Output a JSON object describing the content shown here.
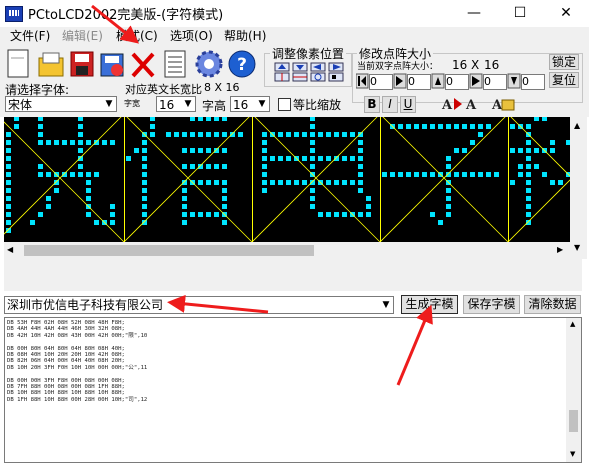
{
  "window": {
    "title": "PCtoLCD2002完美版-(字符模式)",
    "minimize_glyph": "—",
    "maximize_glyph": "☐",
    "close_glyph": "✕"
  },
  "menu": [
    "文件(F)",
    "编辑(E)",
    "模式(C)",
    "选项(O)",
    "帮助(H)"
  ],
  "toolbar": {
    "icons": [
      "new-file-icon",
      "open-folder-icon",
      "save-icon",
      "save-as-icon",
      "delete-icon",
      "document-icon",
      "gear-icon",
      "help-icon"
    ]
  },
  "pixel_adjust": {
    "title": "调整像素位置"
  },
  "dot_size": {
    "title": "修改点阵大小",
    "current_label": "当前双字点阵大小：",
    "width": "16",
    "x_sep": "X",
    "height": "16",
    "lock_button": "锁定",
    "reset_button": "复位",
    "spinner_values": [
      "0",
      "0",
      "0",
      "0",
      "0"
    ]
  },
  "font_row": {
    "select_font_label": "请选择字体:",
    "font_value": "宋体",
    "english_label": "对应英文长宽比",
    "english_ratio": "8 X 16",
    "char_width_label": "字宽",
    "char_width": "16",
    "char_height_label": "字高",
    "char_height": "16",
    "proportional_label": "等比缩放",
    "bold_button": "B",
    "italic_button": "I",
    "underline_button": "U"
  },
  "input": {
    "text": "深圳市优信电子科技有限公司",
    "generate_button": "生成字模",
    "save_button": "保存字模",
    "clear_button": "清除数据"
  },
  "output_lines": [
    "DB 53H F8H 02H 08H 52H 08H 48H F8H;",
    "DB 4AH 44H 4AH 44H 46H 30H 32H 08H;",
    "DB 42H 10H 42H 08H 43H 00H 42H 00H;\"限\",10",
    "",
    "DB 00H 80H 04H 80H 04H 80H 08H 40H;",
    "DB 08H 40H 10H 20H 20H 10H 42H 08H;",
    "DB 82H 06H 04H 00H 04H 40H 08H 20H;",
    "DB 10H 20H 3FH F0H 10H 10H 00H 00H;\"公\",11",
    "",
    "DB 00H 00H 3FH F8H 00H 08H 00H 08H;",
    "DB 7FH 88H 00H 08H 00H 08H 1FH 88H;",
    "DB 10H 88H 10H 88H 10H 88H 10H 88H;",
    "DB 1FH 88H 10H 88H 00H 28H 00H 10H;\"司\",12"
  ],
  "matrix_colors": {
    "background": "#000000",
    "pixel": "#00e5ff",
    "grid": "#ffff00"
  }
}
